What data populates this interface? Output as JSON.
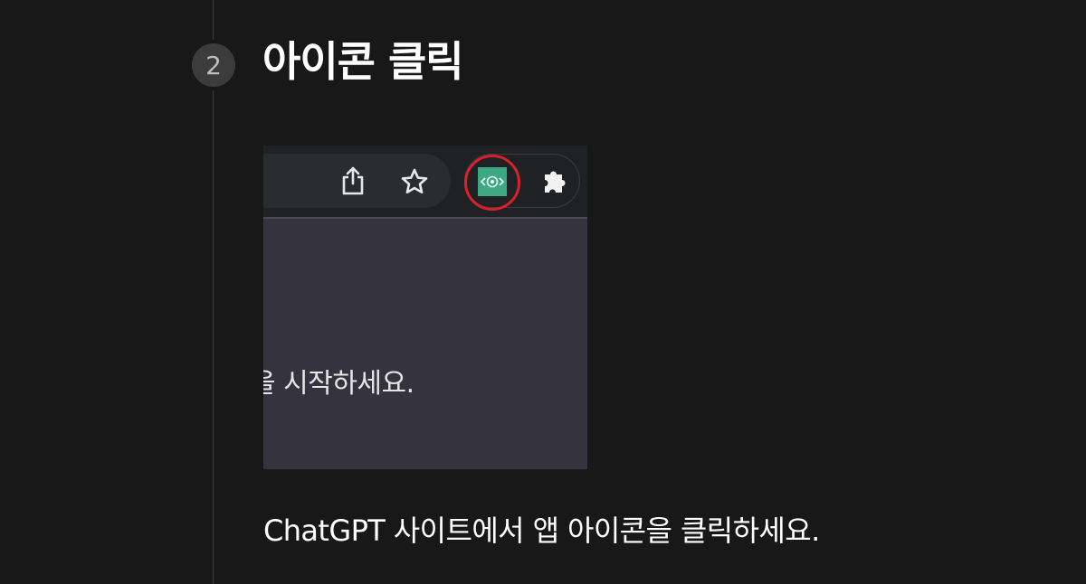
{
  "step": {
    "number": "2",
    "title": "아이콘 클릭",
    "description": "ChatGPT 사이트에서 앱 아이콘을 클릭하세요."
  },
  "screenshot": {
    "body_text": "을 시작하세요.",
    "icons": [
      "share-icon",
      "star-icon",
      "app-extension-icon",
      "puzzle-icon"
    ],
    "app_icon_glyph": "<@>",
    "colors": {
      "app_icon": "#3ea883",
      "highlight": "#d9212b",
      "toolbar": "#202124",
      "content": "#35343e"
    }
  }
}
